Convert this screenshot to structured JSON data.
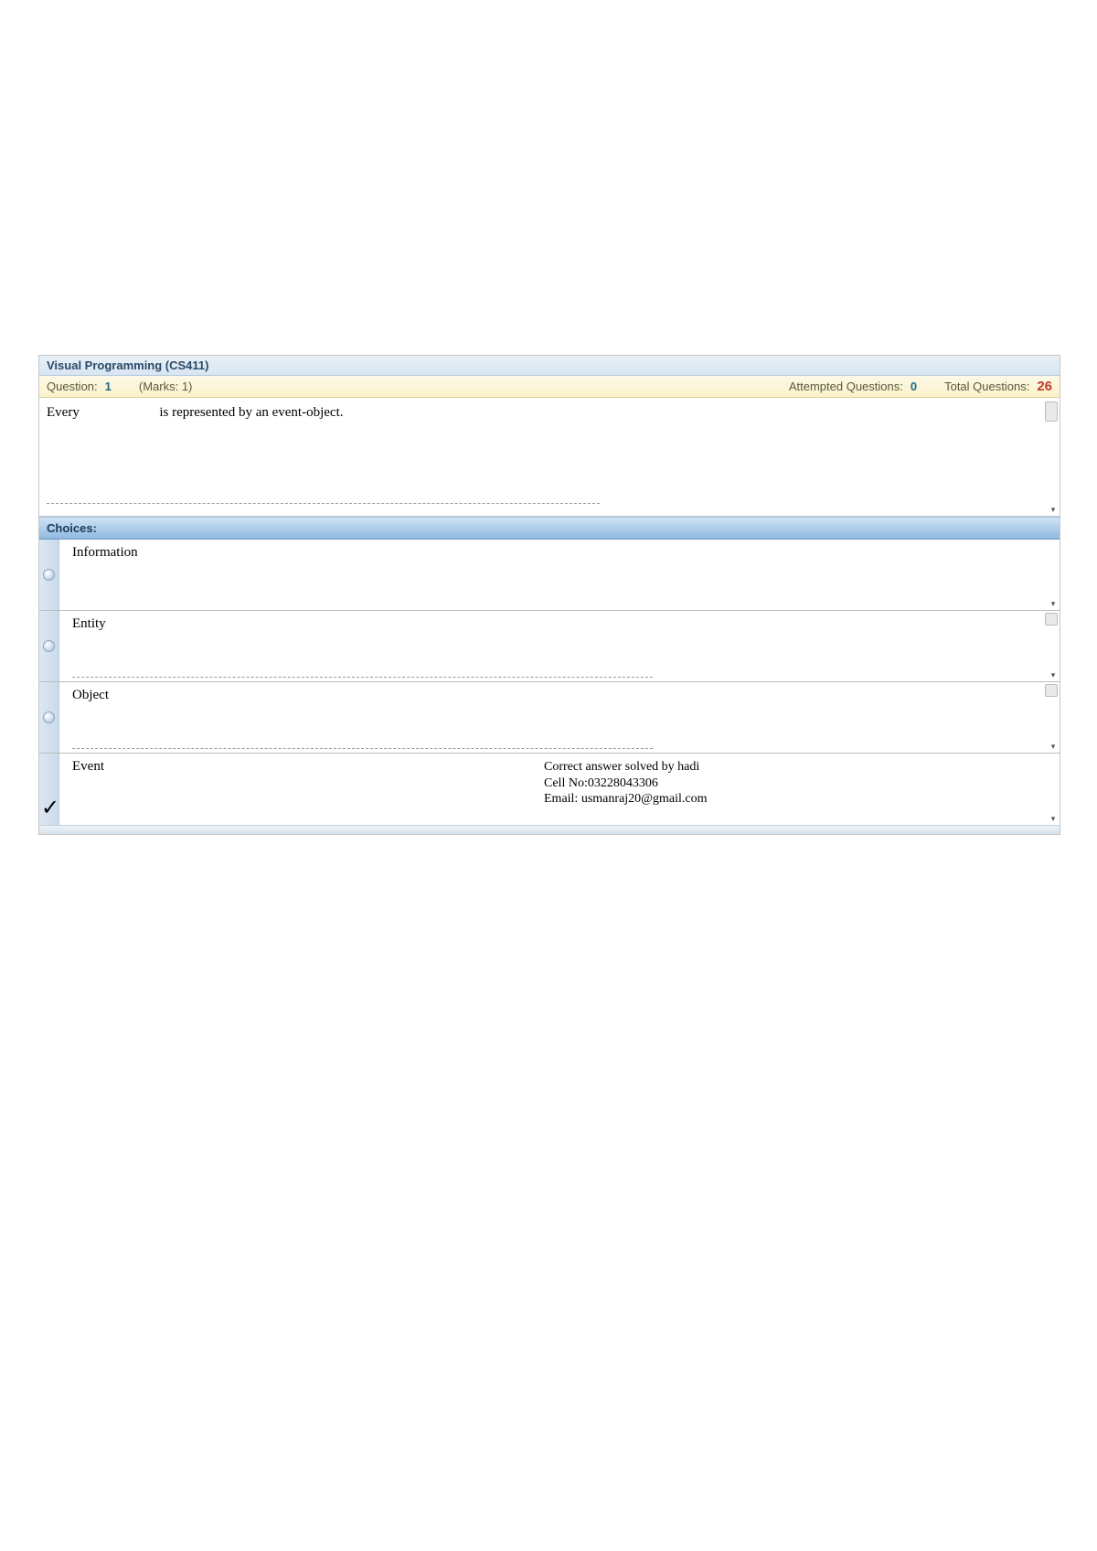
{
  "title": "Visual Programming  (CS411)",
  "info": {
    "question_label": "Question:",
    "question_number": "1",
    "marks": "(Marks: 1)",
    "attempted_label": "Attempted Questions:",
    "attempted_value": "0",
    "total_label": "Total Questions:",
    "total_value": "26"
  },
  "question": {
    "prefix": "Every",
    "suffix": "is represented by an event-object."
  },
  "choices_header": "Choices:",
  "choices": [
    {
      "label": "Information",
      "correct": false,
      "dashed": false
    },
    {
      "label": "Entity",
      "correct": false,
      "dashed": true
    },
    {
      "label": "Object",
      "correct": false,
      "dashed": true
    },
    {
      "label": "Event",
      "correct": true,
      "dashed": false
    }
  ],
  "answer_info": {
    "line1": "Correct answer solved by hadi",
    "line2": "Cell No:03228043306",
    "line3": "Email: usmanraj20@gmail.com"
  }
}
